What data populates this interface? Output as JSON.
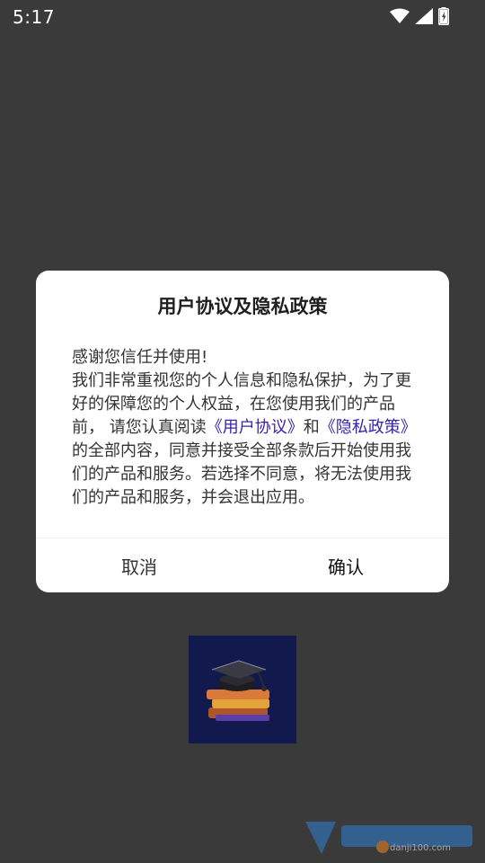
{
  "status_bar": {
    "time": "5:17",
    "icons": [
      "wifi-icon",
      "cellular-signal-icon",
      "battery-charging-icon"
    ]
  },
  "dialog": {
    "title": "用户协议及隐私政策",
    "body": {
      "line1": "感谢您信任并使用!",
      "para_before_link1": "我们非常重视您的个人信息和隐私保护，为了更好的保障您的个人权益，在您使用我们的产品前， 请您认真阅读",
      "link1": "《用户协议》",
      "between_links": "和",
      "link2": "《隐私政策》",
      "para_after_link2": "的全部内容，同意并接受全部条款后开始使用我们的产品和服务。若选择不同意，将无法使用我们的产品和服务，并会退出应用。"
    },
    "cancel_label": "取消",
    "confirm_label": "确认"
  },
  "colors": {
    "backdrop": "#3a3a3a",
    "dialog_bg": "#ffffff",
    "link": "#3a22b0",
    "logo_bg": "#121a4d"
  },
  "background": {
    "app_logo": "graduation-cap-books-icon"
  },
  "watermark": {
    "logo": "site-watermark-logo",
    "domain_text": "danji100.com"
  }
}
